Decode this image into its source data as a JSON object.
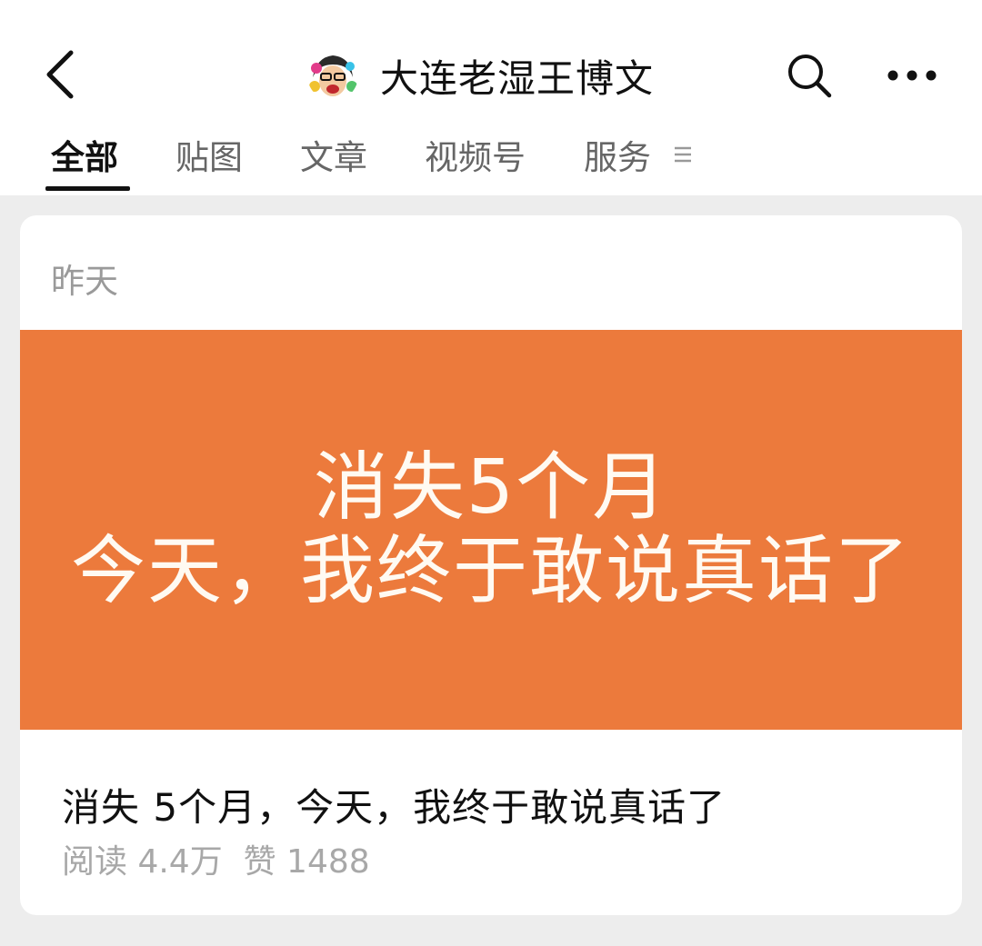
{
  "header": {
    "title": "大连老湿王博文",
    "back_icon": "chevron-left-icon",
    "search_icon": "search-icon",
    "more_icon": "more-horizontal-icon"
  },
  "tabs": [
    {
      "label": "全部",
      "active": true
    },
    {
      "label": "贴图",
      "active": false
    },
    {
      "label": "文章",
      "active": false
    },
    {
      "label": "视频号",
      "active": false
    },
    {
      "label": "服务",
      "active": false
    }
  ],
  "tabs_menu_icon": "menu-lines-icon",
  "post": {
    "date": "昨天",
    "cover_line_1": "消失5个月",
    "cover_line_2": "今天，我终于敢说真话了",
    "cover_color": "#ec7a3c",
    "title": "消失 5个月，今天，我终于敢说真话了",
    "reads": "阅读 4.4万",
    "likes": "赞 1488"
  }
}
